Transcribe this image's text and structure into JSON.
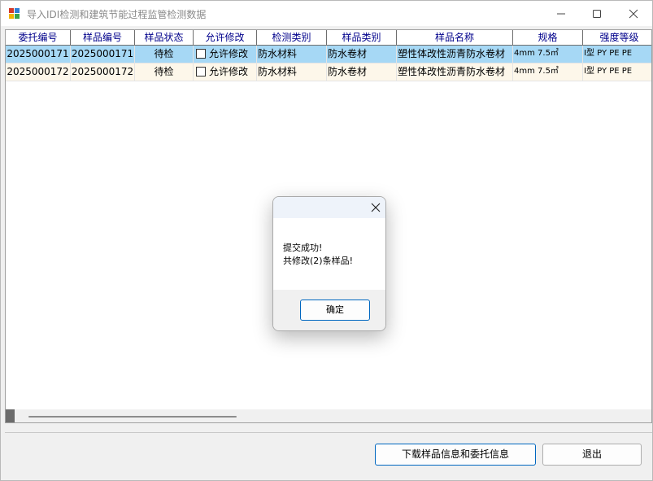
{
  "window": {
    "title": "导入IDI检测和建筑节能过程监管检测数据"
  },
  "grid": {
    "columns": [
      "委托编号",
      "样品编号",
      "样品状态",
      "允许修改",
      "检测类别",
      "样品类别",
      "样品名称",
      "规格",
      "强度等级"
    ],
    "rows": [
      [
        "2025000171",
        "2025000171",
        "待检",
        "允许修改",
        "防水材料",
        "防水卷材",
        "塑性体改性沥青防水卷材",
        "4mm 7.5㎡",
        "Ⅰ型 PY PE PE"
      ],
      [
        "2025000172",
        "2025000172",
        "待检",
        "允许修改",
        "防水材料",
        "防水卷材",
        "塑性体改性沥青防水卷材",
        "4mm 7.5㎡",
        "Ⅰ型 PY PE PE"
      ]
    ]
  },
  "buttons": {
    "download": "下载样品信息和委托信息",
    "exit": "退出"
  },
  "dialog": {
    "line1": "提交成功!",
    "line2": "共修改(2)条样品!",
    "ok": "确定"
  }
}
